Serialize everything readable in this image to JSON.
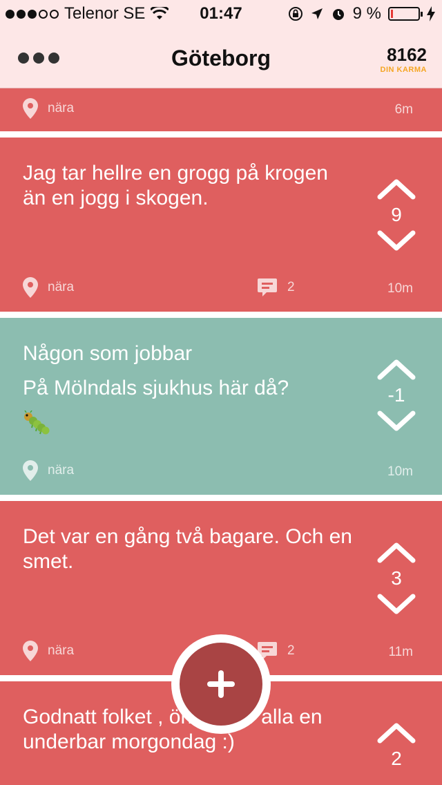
{
  "status_bar": {
    "carrier": "Telenor SE",
    "time": "01:47",
    "battery_percent": "9 %",
    "battery_level": 0.09,
    "signal_bars_filled": 3,
    "signal_bars_total": 5
  },
  "header": {
    "title": "Göteborg",
    "karma_value": "8162",
    "karma_label": "DIN KARMA"
  },
  "colors": {
    "red_post": "#df5f5f",
    "teal_post": "#8cbdb0",
    "fab": "#a94444",
    "karma_accent": "#f5a623"
  },
  "posts": [
    {
      "location": "nära",
      "time": "6m"
    },
    {
      "text_lines": [
        "Jag tar hellre en grogg på krogen än en jogg i skogen."
      ],
      "location": "nära",
      "comment_count": "2",
      "votes": "9",
      "time": "10m"
    },
    {
      "text_lines": [
        "Någon som jobbar",
        "På Mölndals sjukhus här då?"
      ],
      "emoji": "caterpillar",
      "location": "nära",
      "votes": "-1",
      "time": "10m"
    },
    {
      "text_lines": [
        "Det var en gång två bagare. Och en smet."
      ],
      "location": "nära",
      "comment_count": "2",
      "votes": "3",
      "time": "11m"
    },
    {
      "text_lines": [
        "Godnatt folket , önskar er alla en underbar morgondag :)"
      ],
      "votes": "2"
    }
  ],
  "icons": {
    "menu": "more-dots-icon",
    "location": "location-pin-icon",
    "comment": "comment-bubble-icon",
    "upvote": "chevron-up-icon",
    "downvote": "chevron-down-icon",
    "compose": "plus-icon"
  }
}
